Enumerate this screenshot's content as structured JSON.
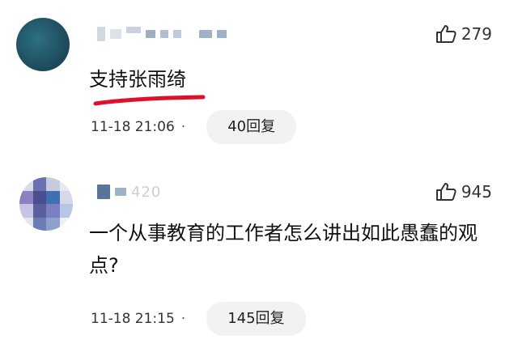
{
  "comments": [
    {
      "likes": "279",
      "text": "支持张雨绮",
      "time": "11-18 21:06",
      "separator": "·",
      "reply_label": "40回复"
    },
    {
      "username_partial": "420",
      "likes": "945",
      "text": "一个从事教育的工作者怎么讲出如此愚蠢的观点?",
      "time": "11-18 21:15",
      "separator": "·",
      "reply_label": "145回复"
    }
  ],
  "colors": {
    "underline": "#e0102b",
    "reply_bg": "#f1f2f4",
    "avatar1": "#1f4e5f"
  },
  "icons": {
    "like": "thumbs-up-outline-icon"
  }
}
